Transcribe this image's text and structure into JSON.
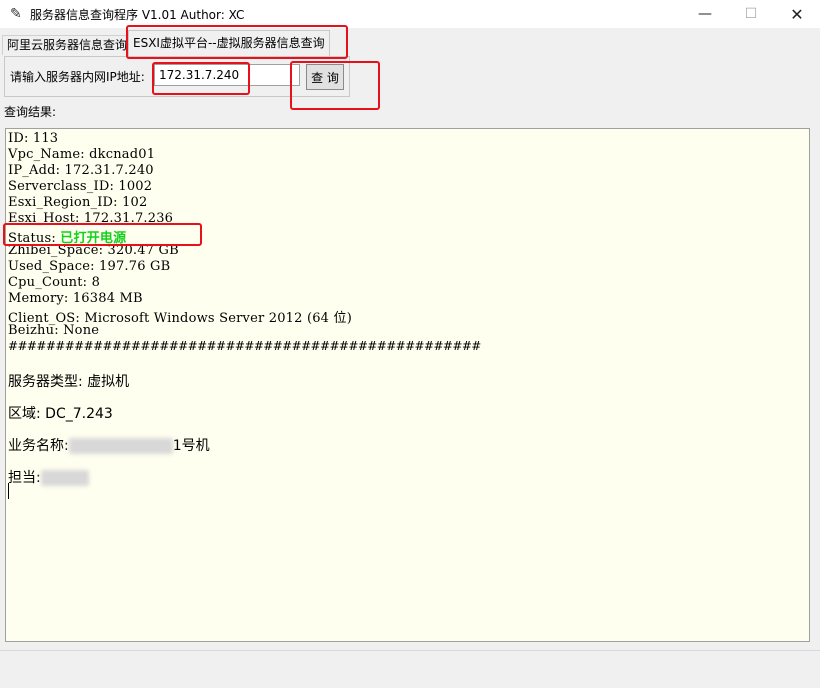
{
  "window": {
    "title": "服务器信息查询程序 V1.01 Author: XC",
    "icon": "feather-icon",
    "minimize_glyph": "—",
    "maximize_glyph": "☐",
    "close_glyph": "✕"
  },
  "tabs": [
    {
      "label": "阿里云服务器信息查询",
      "active": false
    },
    {
      "label": "ESXI虚拟平台--虚拟服务器信息查询",
      "active": true
    }
  ],
  "query": {
    "label": "请输入服务器内网IP地址:",
    "ip_value": "172.31.7.240",
    "button_label": "查 询"
  },
  "result_label": "查询结果:",
  "result": {
    "id": "ID: 113",
    "vpc_name": "Vpc_Name: dkcnad01",
    "ip_add": "IP_Add: 172.31.7.240",
    "serverclass_id": "Serverclass_ID: 1002",
    "esxi_region_id": "Esxi_Region_ID: 102",
    "esxi_host": "Esxi_Host: 172.31.7.236",
    "status_key": "Status: ",
    "status_value": "已打开电源",
    "zhibei_space": "Zhibei_Space: 320.47 GB",
    "used_space": "Used_Space: 197.76 GB",
    "cpu_count": "Cpu_Count: 8",
    "memory": "Memory: 16384 MB",
    "client_os": "Client_OS: Microsoft Windows Server 2012 (64 位)",
    "beizhu": "Beizhu: None",
    "separator": "##################################################",
    "server_type": "服务器类型: 虚拟机",
    "region": "区域: DC_7.243",
    "business_name_label": "业务名称:",
    "business_name_tail": "1号机",
    "owner_label": "担当:"
  },
  "colors": {
    "highlight": "#e8101a",
    "status_green": "#13d11a",
    "result_bg": "#fffff0"
  }
}
